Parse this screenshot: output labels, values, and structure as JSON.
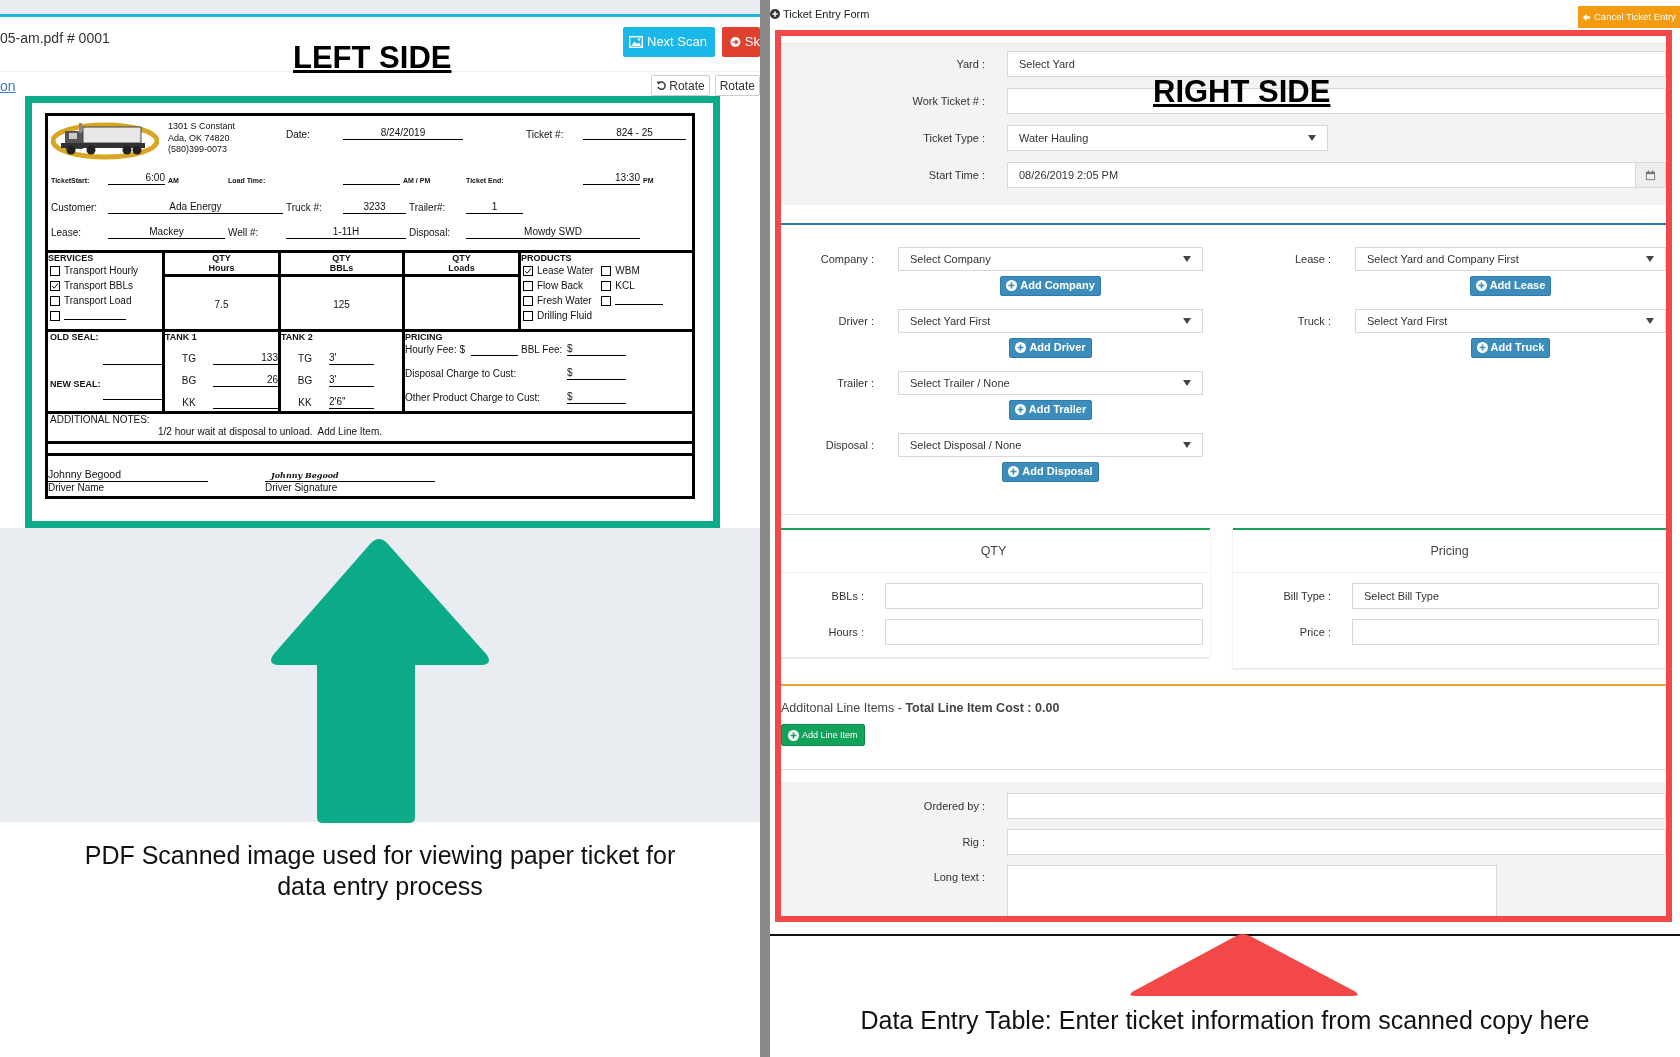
{
  "annotations": {
    "left_heading": "LEFT SIDE",
    "right_heading": "RIGHT SIDE",
    "left_caption": "PDF Scanned image used for viewing paper ticket for data entry process",
    "right_caption": "Data Entry Table: Enter ticket information from scanned copy here"
  },
  "left_panel": {
    "file_name": "05-am.pdf # 0001",
    "buttons": [
      {
        "label": "Next Scan",
        "kind": "scan"
      },
      {
        "label": "Sk",
        "kind": "skip"
      }
    ],
    "link": "on",
    "tools": [
      {
        "label": "Rotate",
        "kind": "rotate-left"
      },
      {
        "label": "Rotate",
        "kind": "plain"
      }
    ]
  },
  "ticket": {
    "address": [
      "1301 S Constant",
      "Ada, OK 74820",
      "(580)399-0073"
    ],
    "info_rows": [
      [
        {
          "label": "Date:",
          "value": "8/24/2019"
        },
        {
          "label": "Ticket #:",
          "value": "824 - 25"
        }
      ],
      [
        {
          "label": "TicketStart:",
          "value": "6:00",
          "suffix": "AM"
        },
        {
          "label": "Load Time:",
          "suffix": "AM / PM"
        },
        {
          "label": "Ticket End:",
          "value": "13:30",
          "suffix": "PM"
        }
      ],
      [
        {
          "label": "Customer:",
          "value": "Ada Energy"
        },
        {
          "label": "Truck #:",
          "value": "3233"
        },
        {
          "label": "Trailer#:",
          "value": "1"
        }
      ],
      [
        {
          "label": "Lease:",
          "value": "Mackey"
        },
        {
          "label": "Well #:",
          "value": "1-11H"
        },
        {
          "label": "Disposal:",
          "value": "Mowdy SWD"
        }
      ]
    ],
    "services": {
      "title": "SERVICES",
      "items": [
        {
          "label": "Transport Hourly",
          "checked": false
        },
        {
          "label": "Transport BBLs",
          "checked": true
        },
        {
          "label": "Transport Load",
          "checked": false
        },
        {
          "checked": false
        }
      ]
    },
    "quantities": [
      {
        "title": "QTY",
        "unit": "Hours",
        "value": "7.5"
      },
      {
        "title": "QTY",
        "unit": "BBLs",
        "value": "125"
      },
      {
        "title": "QTY",
        "unit": "Loads"
      }
    ],
    "products": {
      "title": "PRODUCTS",
      "columns": [
        [
          {
            "label": "Lease Water",
            "checked": true
          },
          {
            "label": "Flow Back",
            "checked": false
          },
          {
            "label": "Fresh Water",
            "checked": false
          },
          {
            "label": "Drilling Fluid",
            "checked": false
          }
        ],
        [
          {
            "label": "WBM",
            "checked": false
          },
          {
            "label": "KCL",
            "checked": false
          },
          {
            "checked": false
          }
        ]
      ]
    },
    "seals": [
      "OLD SEAL:",
      "NEW SEAL:"
    ],
    "tanks": [
      {
        "title": "TANK 1",
        "rows": [
          {
            "label": "TG",
            "value": "133"
          },
          {
            "label": "BG",
            "value": "26"
          },
          {
            "label": "KK"
          }
        ]
      },
      {
        "title": "TANK 2",
        "rows": [
          {
            "label": "TG",
            "value": "3'"
          },
          {
            "label": "BG",
            "value": "3'"
          },
          {
            "label": "KK",
            "value": "2'6\""
          }
        ]
      }
    ],
    "pricing": {
      "title": "PRICING",
      "rows": [
        {
          "label": "Hourly Fee: $",
          "extra_label": "BBL Fee:",
          "amount": "$"
        },
        {
          "label": "Disposal Charge to Cust:",
          "amount": "$"
        },
        {
          "label": "Other Product Charge to Cust:",
          "amount": "$"
        }
      ]
    },
    "notes": {
      "label": "ADDITIONAL NOTES:",
      "text": "1/2 hour wait at disposal to unload.  Add Line Item."
    },
    "signatures": [
      {
        "value": "Johnny Begood",
        "caption": "Driver Name",
        "kind": "print"
      },
      {
        "value": "Johnny Begood",
        "caption": "Driver Signature",
        "kind": "script"
      }
    ]
  },
  "form": {
    "title": "Ticket Entry Form",
    "cancel_button": "Cancel Ticket Entry",
    "top_fields": [
      {
        "label": "Yard :",
        "kind": "text",
        "value": "Select Yard"
      },
      {
        "label": "Work Ticket # :",
        "kind": "text"
      },
      {
        "label": "Ticket Type :",
        "kind": "select",
        "value": "Water Hauling"
      },
      {
        "label": "Start Time :",
        "kind": "date",
        "value": "08/26/2019 2:05 PM"
      }
    ],
    "assignments": {
      "left": [
        {
          "label": "Company :",
          "value": "Select Company",
          "button": "Add Company"
        },
        {
          "label": "Driver :",
          "value": "Select Yard First",
          "button": "Add Driver"
        },
        {
          "label": "Trailer :",
          "value": "Select Trailer / None",
          "button": "Add Trailer"
        },
        {
          "label": "Disposal :",
          "value": "Select Disposal / None",
          "button": "Add Disposal"
        }
      ],
      "right": [
        {
          "label": "Lease :",
          "value": "Select Yard and Company First",
          "button": "Add Lease"
        },
        {
          "label": "Truck :",
          "value": "Select Yard First",
          "button": "Add Truck"
        }
      ]
    },
    "qty_panel": {
      "title": "QTY",
      "fields": [
        {
          "label": "BBLs :"
        },
        {
          "label": "Hours :"
        }
      ]
    },
    "pricing_panel": {
      "title": "Pricing",
      "fields": [
        {
          "label": "Bill Type :",
          "value": "Select Bill Type"
        },
        {
          "label": "Price :"
        }
      ]
    },
    "line_items": {
      "summary": "Additonal Line Items - **Total Line Item Cost : 0.00**",
      "button": "Add Line Item"
    },
    "extra_fields": [
      {
        "label": "Ordered by :",
        "kind": "text"
      },
      {
        "label": "Rig :",
        "kind": "text"
      },
      {
        "label": "Long text :",
        "kind": "textarea"
      }
    ]
  }
}
